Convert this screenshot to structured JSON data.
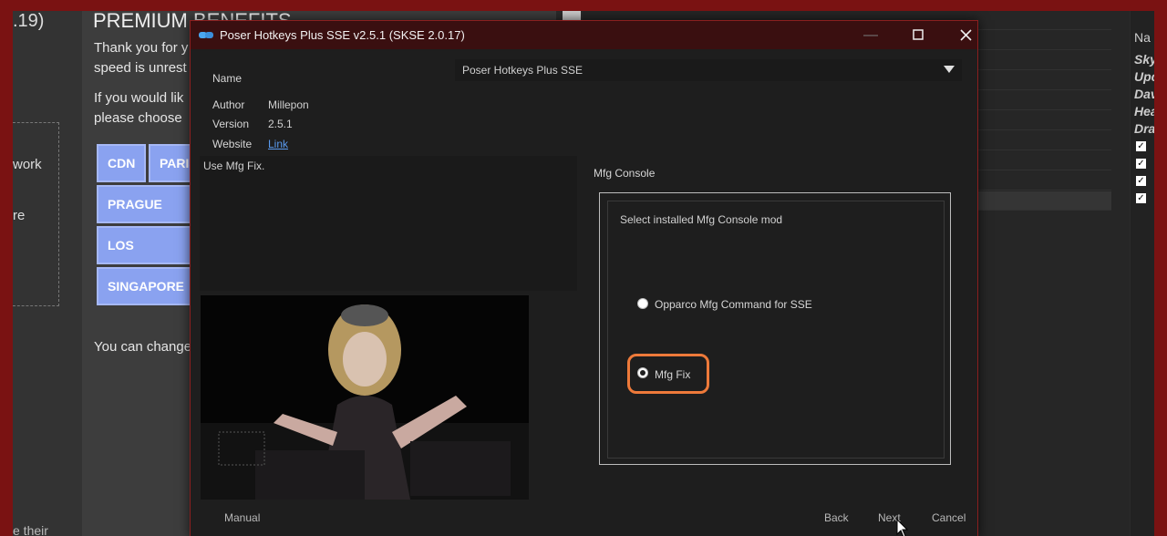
{
  "background": {
    "left_panel": {
      "partial_title": ".19)",
      "line1": "work",
      "line2": "re",
      "line3": "e their"
    },
    "website": {
      "title": "PREMIUM BENEFITS",
      "para1_line1": "Thank you for y",
      "para1_line2": "speed is unrest",
      "para2_line1": "If you would lik",
      "para2_line2": "please choose",
      "servers": [
        "CDN",
        "PARIS",
        "PRAGUE (EU) -",
        "LOS ANGELES",
        "SINGAPORE (A"
      ],
      "para3": "You can change"
    },
    "far_right": {
      "header": "Na",
      "names": [
        "Sky",
        "Upc",
        "Dav",
        "Hea",
        "Dra"
      ]
    }
  },
  "dialog": {
    "title": "Poser Hotkeys Plus SSE v2.5.1 (SKSE 2.0.17)",
    "window_buttons": {
      "minimize": "—",
      "maximize": "☐",
      "close": "✕"
    },
    "name_label": "Name",
    "name_value": "Poser Hotkeys Plus SSE",
    "author_label": "Author",
    "author_value": "Millepon",
    "version_label": "Version",
    "version_value": "2.5.1",
    "website_label": "Website",
    "website_value": "Link",
    "description": "Use Mfg Fix.",
    "preview_text": "",
    "group_title": "Mfg Console",
    "group_label": "Select installed Mfg Console mod",
    "options": [
      {
        "label": "Opparco Mfg Command for SSE",
        "selected": false
      },
      {
        "label": "Mfg Fix",
        "selected": true
      }
    ],
    "footer": {
      "manual": "Manual",
      "back": "Back",
      "next": "Next",
      "cancel": "Cancel"
    }
  },
  "colors": {
    "titlebar": "#3a0f10",
    "dialog_bg": "#1e1e1e",
    "highlight": "#ee7a3a",
    "link": "#5a9bf0",
    "server_button": "#8aa2f0"
  }
}
